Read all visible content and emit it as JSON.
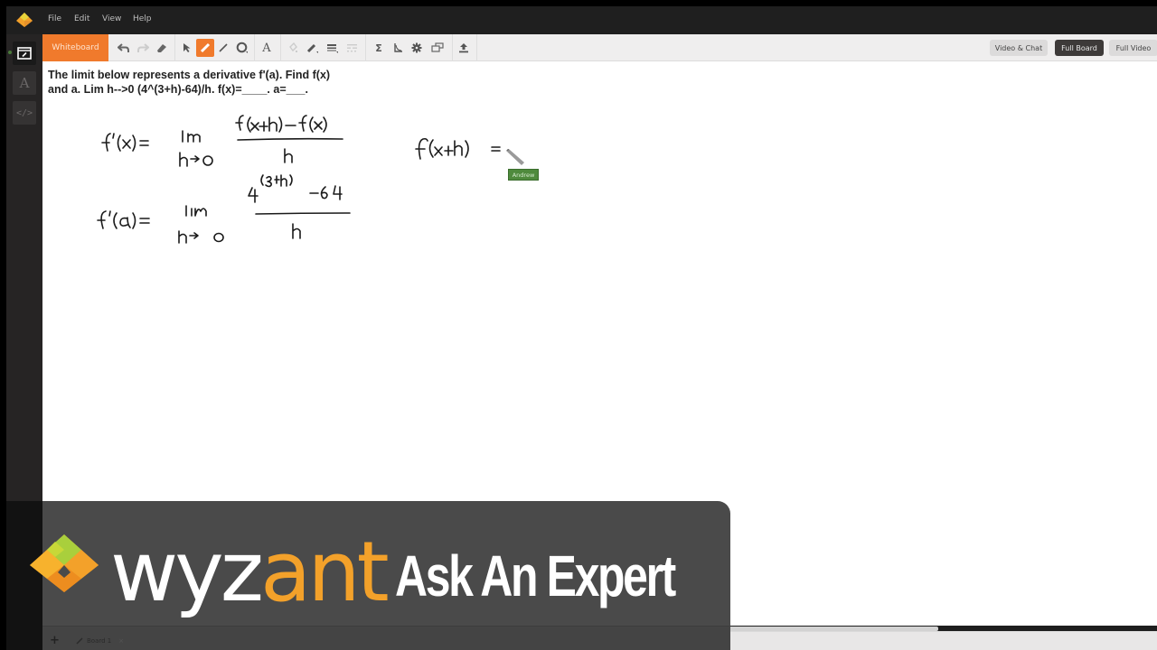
{
  "menubar": {
    "items": [
      "File",
      "Edit",
      "View",
      "Help"
    ]
  },
  "leftrail": {
    "buttons": [
      {
        "name": "whiteboard-mode",
        "icon": "whiteboard-icon",
        "active": true
      },
      {
        "name": "text-mode",
        "icon": "text-A-icon",
        "active": false
      },
      {
        "name": "code-mode",
        "icon": "code-icon",
        "active": false
      }
    ]
  },
  "toolbar": {
    "tab_label": "Whiteboard",
    "tools": [
      "undo",
      "redo",
      "eraser",
      "select",
      "pencil",
      "line",
      "shape",
      "text",
      "fill",
      "pen-color",
      "line-weight",
      "line-style",
      "equation",
      "graph",
      "settings",
      "layers",
      "upload"
    ],
    "active_tool": "pencil",
    "view_buttons": [
      {
        "label": "Video & Chat",
        "active": false
      },
      {
        "label": "Full Board",
        "active": true
      },
      {
        "label": "Full Video",
        "active": false
      }
    ]
  },
  "board": {
    "question_line1": "The limit below represents a derivative f'(a). Find f(x)",
    "question_line2": "and a. Lim h-->0 (4^(3+h)-64)/h. f(x)=____. a=___.",
    "handwriting": [
      "f'(x) = lim h→0 [f(x+h) − f(x)] / h",
      "f'(a) = lim h→0 [4^(3+h) − 64] / h",
      "f(x+h) ="
    ],
    "cursor_user": "Andrew",
    "ink_color": "#1a1a1a",
    "cursor_label_color": "#4f8a3d"
  },
  "bottombar": {
    "add_label": "+",
    "tab_label": "Board 1",
    "tab_close": "×"
  },
  "banner": {
    "brand_white": "wyz",
    "brand_orange": "ant",
    "tagline": "Ask An Expert",
    "brand_orange_color": "#f3a12a"
  }
}
